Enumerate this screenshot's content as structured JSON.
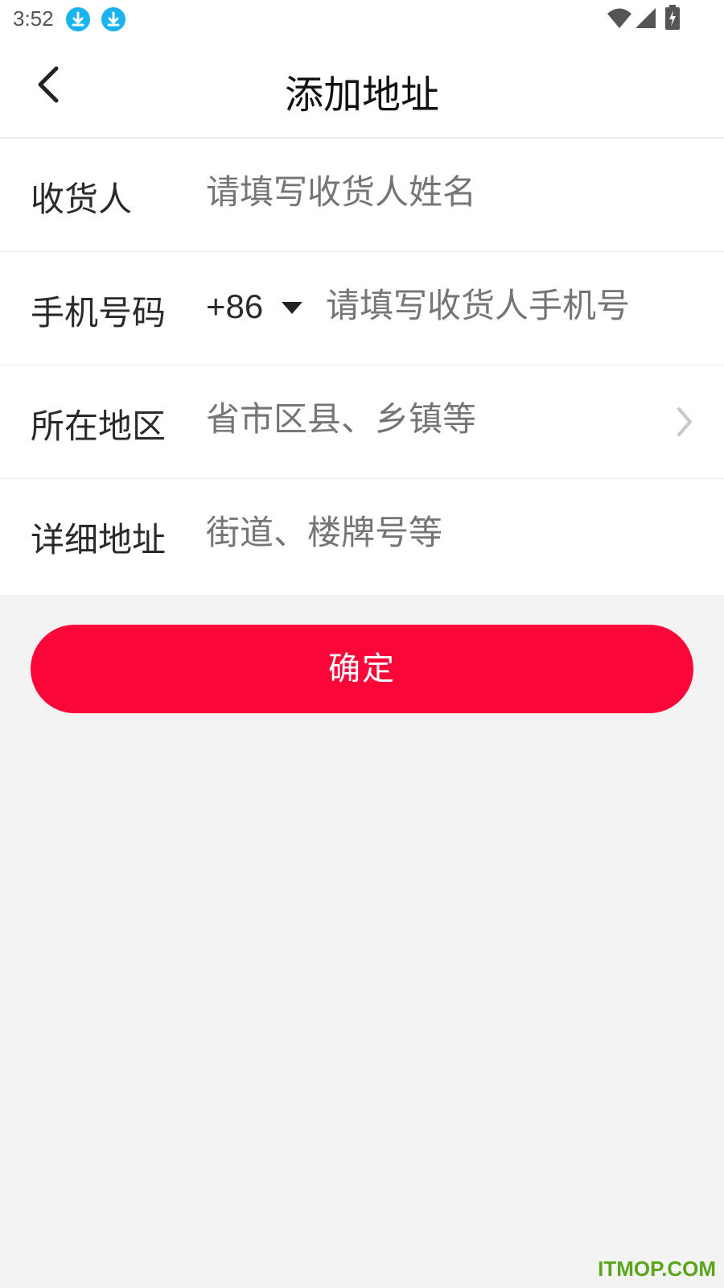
{
  "status_bar": {
    "time": "3:52",
    "icons": [
      "download-icon",
      "download-icon",
      "wifi-icon",
      "signal-icon",
      "battery-charging-icon"
    ]
  },
  "header": {
    "title": "添加地址",
    "back_icon": "back-chevron-icon"
  },
  "form": {
    "receiver": {
      "label": "收货人",
      "placeholder": "请填写收货人姓名"
    },
    "phone": {
      "label": "手机号码",
      "country_code": "+86",
      "placeholder": "请填写收货人手机号"
    },
    "region": {
      "label": "所在地区",
      "placeholder": "省市区县、乡镇等"
    },
    "detail": {
      "label": "详细地址",
      "placeholder": "街道、楼牌号等"
    }
  },
  "confirm_button": {
    "label": "确定"
  },
  "watermark": "ITMOP.COM",
  "colors": {
    "accent": "#fb0638",
    "download_badge": "#19b4ee",
    "placeholder": "#b3b3b3",
    "watermark": "#5aa51a"
  }
}
